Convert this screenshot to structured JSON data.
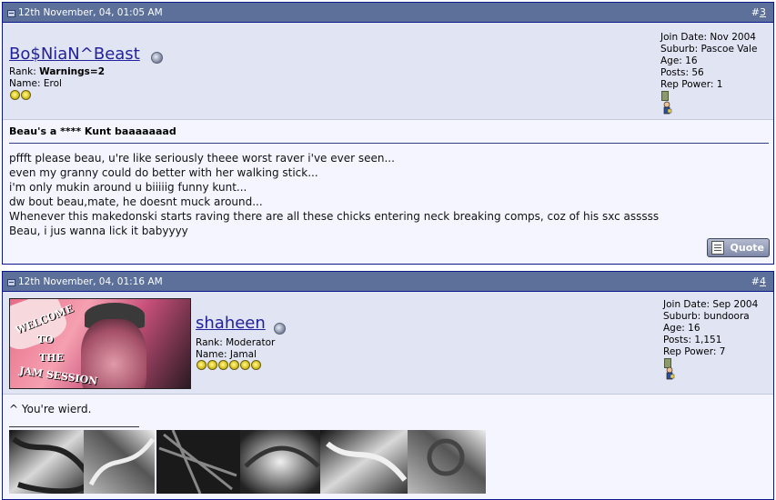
{
  "posts": [
    {
      "date": "12th November, 04, 01:05 AM",
      "post_number_prefix": "#",
      "post_number": "3",
      "username": "Bo$NiaN^Beast",
      "rank_label": "Rank:",
      "rank_value": "Warnings=2",
      "name_label": "Name:",
      "name_value": "Erol",
      "stars": 2,
      "join_date": "Join Date: Nov 2004",
      "suburb": "Suburb: Pascoe Vale",
      "age": "Age: 16",
      "posts": "Posts: 56",
      "rep_power": "Rep Power: 1",
      "title": "Beau's a **** Kunt baaaaaaad",
      "message": [
        "pffft please beau, u're like seriously theee worst raver i've ever seen...",
        "even my granny could do better with her walking stick...",
        "i'm only mukin around u biiiiig funny kunt...",
        "dw bout beau,mate, he doesnt muck around...",
        "Whenever this makedonski starts raving there are all these chicks entering neck breaking comps, coz of his sxc asssss",
        "Beau, i jus wanna lick it babyyyy"
      ],
      "quote_label": "Quote"
    },
    {
      "date": "12th November, 04, 01:16 AM",
      "post_number_prefix": "#",
      "post_number": "4",
      "username": "shaheen",
      "rank_label": "Rank:",
      "rank_value": "Moderator",
      "name_label": "Name:",
      "name_value": "Jamal",
      "stars": 6,
      "join_date": "Join Date: Sep 2004",
      "suburb": "Suburb: bundoora",
      "age": "Age: 16",
      "posts": "Posts: 1,151",
      "rep_power": "Rep Power: 7",
      "message": [
        "^ You're wierd."
      ],
      "avatar_text": [
        "WELCOME",
        "TO",
        "THE",
        "JAM SESSION"
      ]
    }
  ],
  "icons": {
    "post_icon": "post-icon",
    "online_status": "online-status-icon",
    "reputation": "reputation-icon",
    "star": "star-icon"
  },
  "colors": {
    "thead": "#5c7099",
    "userinfo_bg": "#e1e4f2",
    "body_bg": "#f5f5ff",
    "username": "#22229c",
    "border": "#0b198c"
  }
}
